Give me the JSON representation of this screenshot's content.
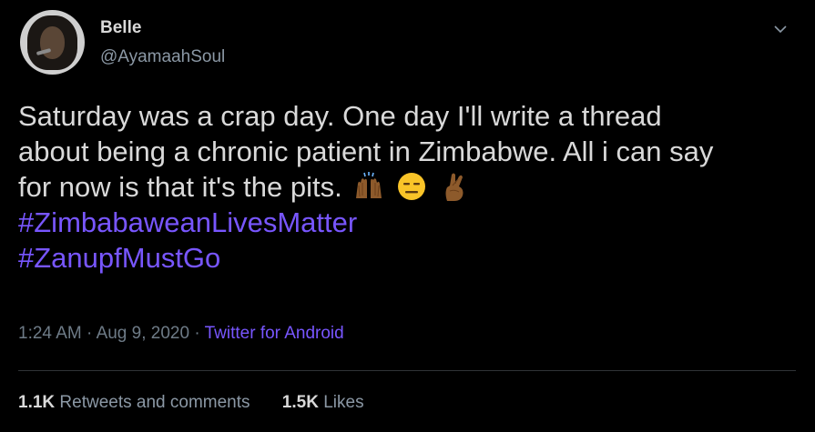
{
  "author": {
    "name": "Belle",
    "handle": "@AyamaahSoul"
  },
  "tweet": {
    "lines": [
      "Saturday was a crap day. One day I'll write a thread",
      "about being a chronic patient in Zimbabwe. All i can say",
      "for now is that it's the pits."
    ],
    "emojis": [
      "raising-hands-emoji",
      "expressionless-face-emoji",
      "crossed-fingers-emoji"
    ],
    "hashtags": [
      "#ZimbabaweanLivesMatter",
      "#ZanupfMustGo"
    ]
  },
  "meta": {
    "time": "1:24 AM",
    "separator": "·",
    "date": "Aug 9, 2020",
    "source": "Twitter for Android"
  },
  "stats": {
    "retweets_count": "1.1K",
    "retweets_label": "Retweets and comments",
    "likes_count": "1.5K",
    "likes_label": "Likes"
  },
  "colors": {
    "background": "#000000",
    "text": "#d9d9d9",
    "secondary": "#6e7b87",
    "accent": "#7856ff",
    "divider": "#2f3336"
  },
  "icons": {
    "menu": "chevron-down-icon"
  }
}
